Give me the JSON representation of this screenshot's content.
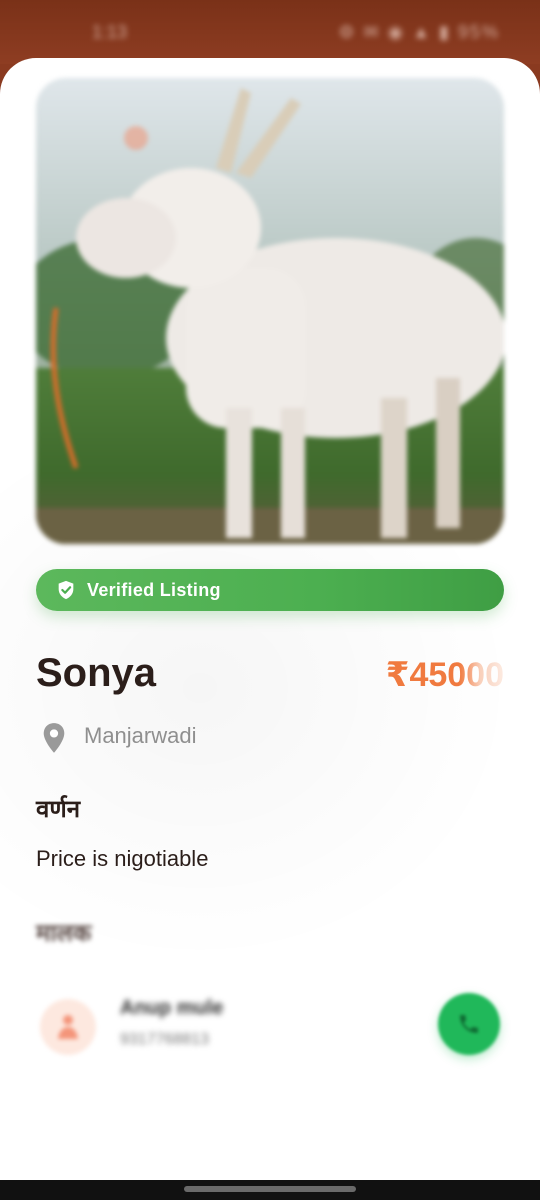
{
  "status_bar": {
    "time": "1:13",
    "icons": "⚙ ✉ ◉ ▲ ▮ 95%"
  },
  "listing": {
    "verified_label": "Verified Listing",
    "name": "Sonya",
    "price": "₹45000",
    "location": "Manjarwadi",
    "description_heading": "वर्णन",
    "description": "Price is nigotiable",
    "owner_heading": "मालक",
    "owner_name": "Anup mule",
    "owner_phone": "9317768813"
  },
  "colors": {
    "accent_green": "#4caf50",
    "price_orange": "#f07a3f",
    "call_green": "#20b85a",
    "header_brown": "#8a3a20"
  },
  "icons": {
    "verified": "shield-check-icon",
    "location": "location-pin-icon",
    "avatar": "person-icon",
    "call": "phone-icon"
  }
}
